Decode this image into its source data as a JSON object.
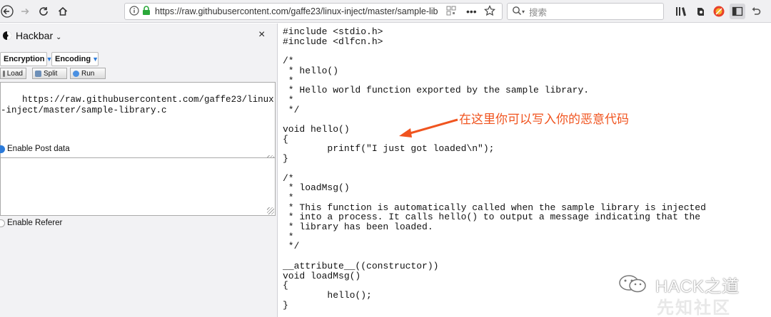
{
  "browser": {
    "url": "https://raw.githubusercontent.com/gaffe23/linux-inject/master/sample-lib",
    "search_placeholder": "搜索"
  },
  "hackbar": {
    "title": "Hackbar",
    "close": "×",
    "dropdowns": [
      "Encryption",
      "Encoding"
    ],
    "buttons": [
      "Load",
      "Split",
      "Run"
    ],
    "url_value": "https://raw.githubusercontent.com/gaffe23/linux-inject/master/sample-library.c",
    "enable_post_data": "Enable Post data",
    "enable_referer": "Enable Referer"
  },
  "code": {
    "lines": [
      "#include <stdio.h>",
      "#include <dlfcn.h>",
      "",
      "/*",
      " * hello()",
      " *",
      " * Hello world function exported by the sample library.",
      " *",
      " */",
      "",
      "void hello()",
      "{",
      "        printf(\"I just got loaded\\n\");",
      "}",
      "",
      "/*",
      " * loadMsg()",
      " *",
      " * This function is automatically called when the sample library is injected",
      " * into a process. It calls hello() to output a message indicating that the",
      " * library has been loaded.",
      " *",
      " */",
      "",
      "__attribute__((constructor))",
      "void loadMsg()",
      "{",
      "        hello();",
      "}"
    ]
  },
  "annotation": "在这里你可以写入你的恶意代码",
  "watermark": {
    "text": "HACK之道",
    "text2": "先知社区"
  },
  "colors": {
    "annotation": "#f0541f",
    "dropdown_arrow": "#2b7ad9",
    "secure_lock": "#2aa83a"
  }
}
